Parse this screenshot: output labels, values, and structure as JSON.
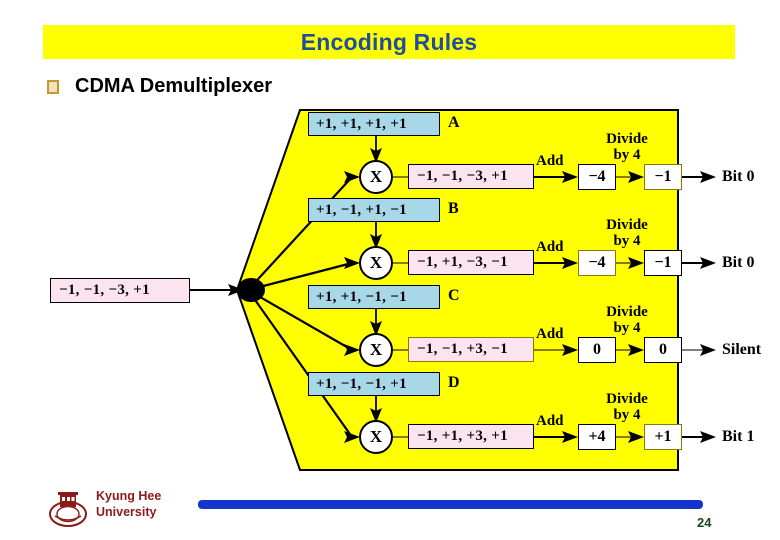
{
  "slide": {
    "title": "Encoding Rules",
    "bullet": {
      "marker": "square-bullet-icon",
      "label": "CDMA Demultiplexer"
    }
  },
  "diagram": {
    "input_signal": "−1, −1, −3, +1",
    "junction": "splitter-node",
    "multiply_symbol": "X",
    "add_label": "Add",
    "divide_label_line1": "Divide",
    "divide_label_line2": "by 4",
    "rows": [
      {
        "letter": "A",
        "code": "+1, +1, +1, +1",
        "product": "−1, −1, −3, +1",
        "sum": "−4",
        "divided": "−1",
        "output": "Bit 0"
      },
      {
        "letter": "B",
        "code": "+1, −1, +1, −1",
        "product": "−1, +1, −3, −1",
        "sum": "−4",
        "divided": "−1",
        "output": "Bit 0"
      },
      {
        "letter": "C",
        "code": "+1, +1, −1, −1",
        "product": "−1, −1, +3, −1",
        "sum": "0",
        "divided": "0",
        "output": "Silent"
      },
      {
        "letter": "D",
        "code": "+1, −1, −1, +1",
        "product": "−1, +1, +3, +1",
        "sum": "+4",
        "divided": "+1",
        "output": "Bit 1"
      }
    ]
  },
  "footer": {
    "university": "Kyung Hee\nUniversity",
    "page_number": "24"
  },
  "colors": {
    "title_bar": "#ffff00",
    "title_text": "#1f4e9c",
    "diagram_fill": "#ffff00",
    "code_box": "#a8d8e8",
    "signal_box": "#fbe4ef",
    "rule": "#1434cb",
    "university_text": "#8b1a1a",
    "page_number_text": "#1e4620"
  }
}
